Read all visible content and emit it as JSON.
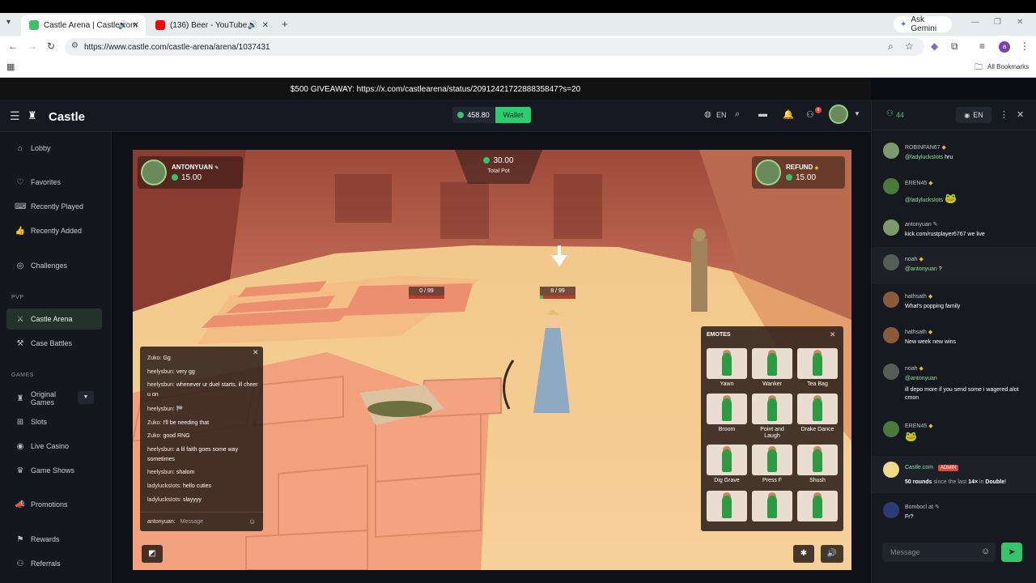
{
  "browser": {
    "tabs": [
      {
        "label": "Castle Arena | Castle.com",
        "active": true
      },
      {
        "label": "(136) Beer - YouTube",
        "active": false
      }
    ],
    "ask_gemini": "Ask Gemini",
    "url": "https://www.castle.com/castle-arena/arena/1037431",
    "profile_initial": "a",
    "all_bookmarks": "All Bookmarks"
  },
  "banner": {
    "text": "$500 GIVEAWAY: https://x.com/castlearena/status/2091242172288835847?s=20"
  },
  "header": {
    "logo": "Castle",
    "balance": "458.80",
    "wallet_label": "Wallet",
    "language": "EN",
    "notification_count": "9"
  },
  "sidebar": {
    "items": [
      {
        "label": "Lobby",
        "icon": "home-icon"
      },
      {
        "label": "Favorites",
        "icon": "heart-icon"
      },
      {
        "label": "Recently Played",
        "icon": "controller-icon"
      },
      {
        "label": "Recently Added",
        "icon": "thumbs-up-icon"
      },
      {
        "label": "Challenges",
        "icon": "target-icon"
      }
    ],
    "pvp_section": "PVP",
    "pvp_items": [
      {
        "label": "Castle Arena",
        "icon": "swords-icon",
        "active": true
      },
      {
        "label": "Case Battles",
        "icon": "sword-icon"
      }
    ],
    "games_section": "GAMES",
    "games_items": [
      {
        "label": "Original Games",
        "icon": "castle-icon"
      },
      {
        "label": "Slots",
        "icon": "slot-icon"
      },
      {
        "label": "Live Casino",
        "icon": "chip-icon"
      },
      {
        "label": "Game Shows",
        "icon": "crown-icon"
      },
      {
        "label": "Promotions",
        "icon": "megaphone-icon"
      },
      {
        "label": "Rewards",
        "icon": "gift-icon"
      },
      {
        "label": "Referrals",
        "icon": "users-icon"
      }
    ]
  },
  "game": {
    "player_left": {
      "name": "ANTONYUAN",
      "amount": "15.00"
    },
    "player_right": {
      "name": "REFUND",
      "amount": "15.00"
    },
    "pot": {
      "amount": "30.00",
      "label": "Total Pot"
    },
    "hp_left": {
      "value": 0,
      "max": 99,
      "text": "0 / 99"
    },
    "hp_right": {
      "value": 8,
      "max": 99,
      "text": "8 / 99"
    },
    "chat": {
      "lines": [
        {
          "user": "Zuko:",
          "msg": "Gg"
        },
        {
          "user": "heelysbun:",
          "msg": "very gg"
        },
        {
          "user": "heelysbun:",
          "msg": "whenever ur duel starts, ill cheer u on"
        },
        {
          "user": "heelysbun:",
          "msg": "🏁"
        },
        {
          "user": "Zuko:",
          "msg": "I'll be needing that"
        },
        {
          "user": "Zuko:",
          "msg": "good RNG"
        },
        {
          "user": "heelysbun:",
          "msg": "a lil faith goes some way sometimes"
        },
        {
          "user": "heelysbun:",
          "msg": "shalom"
        },
        {
          "user": "ladylucksIots:",
          "msg": "hello cuties"
        },
        {
          "user": "ladylucksIots:",
          "msg": "slayyyy"
        }
      ],
      "self_user": "antonyuan:",
      "placeholder": "Message"
    },
    "emotes": {
      "title": "EMOTES",
      "items": [
        "Yawn",
        "Wanker",
        "Tea Bag",
        "Broom",
        "Point and Laugh",
        "Drake Dance",
        "Dig Grave",
        "Press F",
        "Shush"
      ]
    }
  },
  "right_chat": {
    "online_count": "44",
    "language": "EN",
    "messages": [
      {
        "name": "ROBINFAN67",
        "mention": "@ladylucksIots",
        "text": "hru"
      },
      {
        "name": "EREN45",
        "mention": "@ladylucksIots",
        "text": "🐸"
      },
      {
        "name": "antonyuan",
        "mention": "",
        "text": "kick.com/rustplayer6767 we live"
      },
      {
        "name": "noah",
        "mention": "@antonyuan",
        "text": "?"
      },
      {
        "name": "hathsath",
        "mention": "",
        "text": "What's popping family"
      },
      {
        "name": "hathsath",
        "mention": "",
        "text": "New week new wins"
      },
      {
        "name": "noah",
        "mention": "@antonyuan",
        "text": "ill depo more if you send some i wagered alot cmon"
      },
      {
        "name": "EREN45",
        "mention": "",
        "text": "🐸"
      },
      {
        "name": "Castle.com",
        "badge": "ADMIN",
        "text_parts": [
          "50 rounds",
          " since the last ",
          "14×",
          " in ",
          "Double",
          "!"
        ]
      },
      {
        "name": "Bombocl at",
        "mention": "",
        "text": "Fr?"
      }
    ],
    "placeholder": "Message"
  },
  "colors": {
    "accent_green": "#35c46b",
    "wallet_green": "#2ecc71",
    "admin_red": "#e0463e"
  }
}
